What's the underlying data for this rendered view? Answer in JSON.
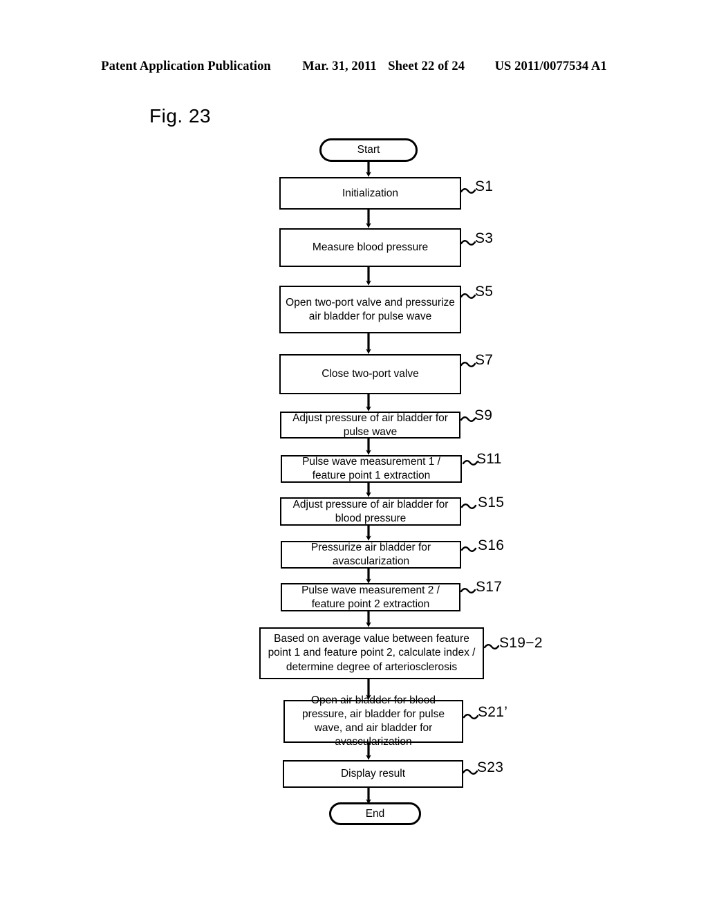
{
  "header": {
    "publication": "Patent Application Publication",
    "date": "Mar. 31, 2011",
    "sheet": "Sheet 22 of 24",
    "docnumber": "US 2011/0077534 A1"
  },
  "figure": {
    "label": "Fig. 23"
  },
  "flowchart": {
    "type": "flowchart",
    "nodes": [
      {
        "id": "start",
        "shape": "terminal",
        "text": "Start",
        "step": ""
      },
      {
        "id": "s1",
        "shape": "process",
        "text": "Initialization",
        "step": "S1"
      },
      {
        "id": "s3",
        "shape": "process",
        "text": "Measure blood pressure",
        "step": "S3"
      },
      {
        "id": "s5",
        "shape": "process",
        "text": "Open two-port valve and pressurize air bladder for pulse wave",
        "step": "S5"
      },
      {
        "id": "s7",
        "shape": "process",
        "text": "Close two-port valve",
        "step": "S7"
      },
      {
        "id": "s9",
        "shape": "process",
        "text": "Adjust pressure of air bladder for pulse wave",
        "step": "S9"
      },
      {
        "id": "s11",
        "shape": "process",
        "text": "Pulse wave measurement 1 / feature point 1 extraction",
        "step": "S11"
      },
      {
        "id": "s15",
        "shape": "process",
        "text": "Adjust pressure of air bladder for blood pressure",
        "step": "S15"
      },
      {
        "id": "s16",
        "shape": "process",
        "text": "Pressurize air bladder for avascularization",
        "step": "S16"
      },
      {
        "id": "s17",
        "shape": "process",
        "text": "Pulse wave measurement 2 / feature point 2 extraction",
        "step": "S17"
      },
      {
        "id": "s19_2",
        "shape": "process",
        "text": "Based on average value between feature point 1 and feature point 2, calculate index / determine degree of arteriosclerosis",
        "step": "S19−2"
      },
      {
        "id": "s21p",
        "shape": "process",
        "text": "Open air bladder for blood pressure, air bladder for pulse wave, and air bladder for avascularization",
        "step": "S21’"
      },
      {
        "id": "s23",
        "shape": "process",
        "text": "Display result",
        "step": "S23"
      },
      {
        "id": "end",
        "shape": "terminal",
        "text": "End",
        "step": ""
      }
    ]
  }
}
